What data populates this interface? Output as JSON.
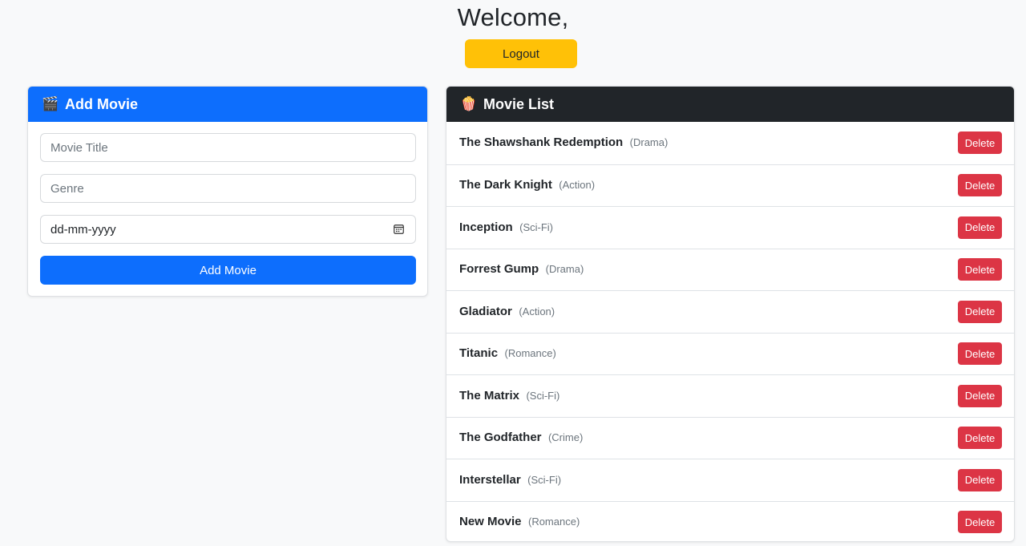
{
  "header": {
    "welcome": "Welcome,",
    "logout_label": "Logout"
  },
  "add_card": {
    "icon": "🎬",
    "title": "Add Movie",
    "title_placeholder": "Movie Title",
    "genre_placeholder": "Genre",
    "date_value": "dd-mm-yyyy",
    "submit_label": "Add Movie"
  },
  "list_card": {
    "icon": "🍿",
    "title": "Movie List",
    "delete_label": "Delete",
    "movies": [
      {
        "title": "The Shawshank Redemption",
        "genre": "(Drama)"
      },
      {
        "title": "The Dark Knight",
        "genre": "(Action)"
      },
      {
        "title": "Inception",
        "genre": "(Sci-Fi)"
      },
      {
        "title": "Forrest Gump",
        "genre": "(Drama)"
      },
      {
        "title": "Gladiator",
        "genre": "(Action)"
      },
      {
        "title": "Titanic",
        "genre": "(Romance)"
      },
      {
        "title": "The Matrix",
        "genre": "(Sci-Fi)"
      },
      {
        "title": "The Godfather",
        "genre": "(Crime)"
      },
      {
        "title": "Interstellar",
        "genre": "(Sci-Fi)"
      },
      {
        "title": "New Movie",
        "genre": "(Romance)"
      }
    ]
  },
  "colors": {
    "primary": "#0d6efd",
    "warning": "#ffc107",
    "danger": "#dc3545",
    "dark": "#212529"
  }
}
